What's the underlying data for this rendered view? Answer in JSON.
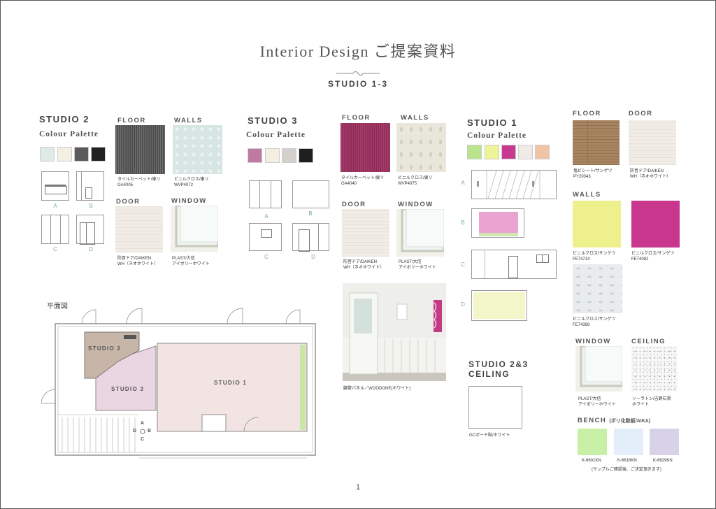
{
  "title": "Interior Design ご提案資料",
  "subtitle": "STUDIO 1-3",
  "page_number": "1",
  "colors": {
    "accent_green": "#c8e6a8",
    "accent_magenta": "#c63d92",
    "accent_yellow": "#eef48a"
  },
  "studio2": {
    "heading": "STUDIO 2",
    "palette_label": "Colour Palette",
    "palette": [
      "#dfe9e6",
      "#f4efe3",
      "#5b5b5b",
      "#222222"
    ],
    "elevation_labels": [
      "A",
      "B",
      "C",
      "D"
    ],
    "floor": {
      "label": "FLOOR",
      "caption1": "タイルカーペット/東リ",
      "caption2": "GA4005"
    },
    "walls": {
      "label": "WALLS",
      "caption1": "ビニルクロス/東リ",
      "caption2": "WVP4072"
    },
    "door": {
      "label": "DOOR",
      "caption1": "防音ドア/DAIKEN",
      "caption2": "WH（ネオホワイト）"
    },
    "window": {
      "label": "WINDOW",
      "caption1": "PLAST/大信",
      "caption2": "アイボリーホワイト"
    }
  },
  "studio3": {
    "heading": "STUDIO 3",
    "palette_label": "Colour Palette",
    "palette": [
      "#c07aa2",
      "#f5efe2",
      "#d4d1cc",
      "#1e1e1e"
    ],
    "elevation_labels": [
      "A",
      "B",
      "C",
      "D"
    ],
    "floor": {
      "label": "FLOOR",
      "caption1": "タイルカーペット/東リ",
      "caption2": "GA4040"
    },
    "walls": {
      "label": "WALLS",
      "caption1": "ビニルクロス/東リ",
      "caption2": "WVP4075"
    },
    "door": {
      "label": "DOOR",
      "caption1": "防音ドア/DAIKEN",
      "caption2": "WH（ネオホワイト）"
    },
    "window": {
      "label": "WINDOW",
      "caption1": "PLAST/大信",
      "caption2": "アイボリーホワイト"
    },
    "photo_caption": "腰壁パネル／WOODONE(ホワイト)"
  },
  "studio1": {
    "heading": "STUDIO 1",
    "palette_label": "Colour Palette",
    "palette": [
      "#b9e48c",
      "#eef398",
      "#c9398f",
      "#f0ebe6",
      "#f0c3a6"
    ],
    "elevation_labels": [
      "A",
      "B",
      "C",
      "D"
    ],
    "floor": {
      "label": "FLOOR",
      "caption1": "塩ビシート/サンゲツ",
      "caption2": "PY20343"
    },
    "door": {
      "label": "DOOR",
      "caption1": "防音ドア/DAIKEN",
      "caption2": "WH（ネオホワイト）"
    },
    "walls": {
      "label": "WALLS",
      "items": [
        {
          "caption1": "ビニルクロス/サンゲツ",
          "caption2": "FE74714",
          "color": "#eef08e"
        },
        {
          "caption1": "ビニルクロス/サンゲツ",
          "caption2": "FE74082",
          "color": "#c8378d"
        },
        {
          "caption1": "ビニルクロス/サンゲツ",
          "caption2": "FE74398",
          "color": "#e8ecec"
        }
      ]
    },
    "window": {
      "label": "WINDOW",
      "caption1": "PLAST/大信",
      "caption2": "アイボリーホワイト"
    },
    "ceiling": {
      "label": "CEILING",
      "caption1": "ソーラトン/吉野石膏",
      "caption2": "ホワイト"
    },
    "bench": {
      "label": "BENCH",
      "label_note": "(ポリ化粧板/AIKA)",
      "items": [
        {
          "code": "K-6601KN",
          "color": "#c7f0a6"
        },
        {
          "code": "K-6616KN",
          "color": "#e4eefa"
        },
        {
          "code": "K-6629KN",
          "color": "#d8d2e8"
        }
      ],
      "note": "(サンプルご確認後、ご決定頂きます)"
    }
  },
  "studio23_ceiling": {
    "heading1": "STUDIO 2&3",
    "heading2": "CEILING",
    "caption": "GCボード貼/ホワイト"
  },
  "floor_plan": {
    "label": "平面図",
    "room_labels": [
      "STUDIO 2",
      "STUDIO 3",
      "STUDIO 1"
    ],
    "compass": [
      "A",
      "B",
      "C",
      "D"
    ]
  }
}
